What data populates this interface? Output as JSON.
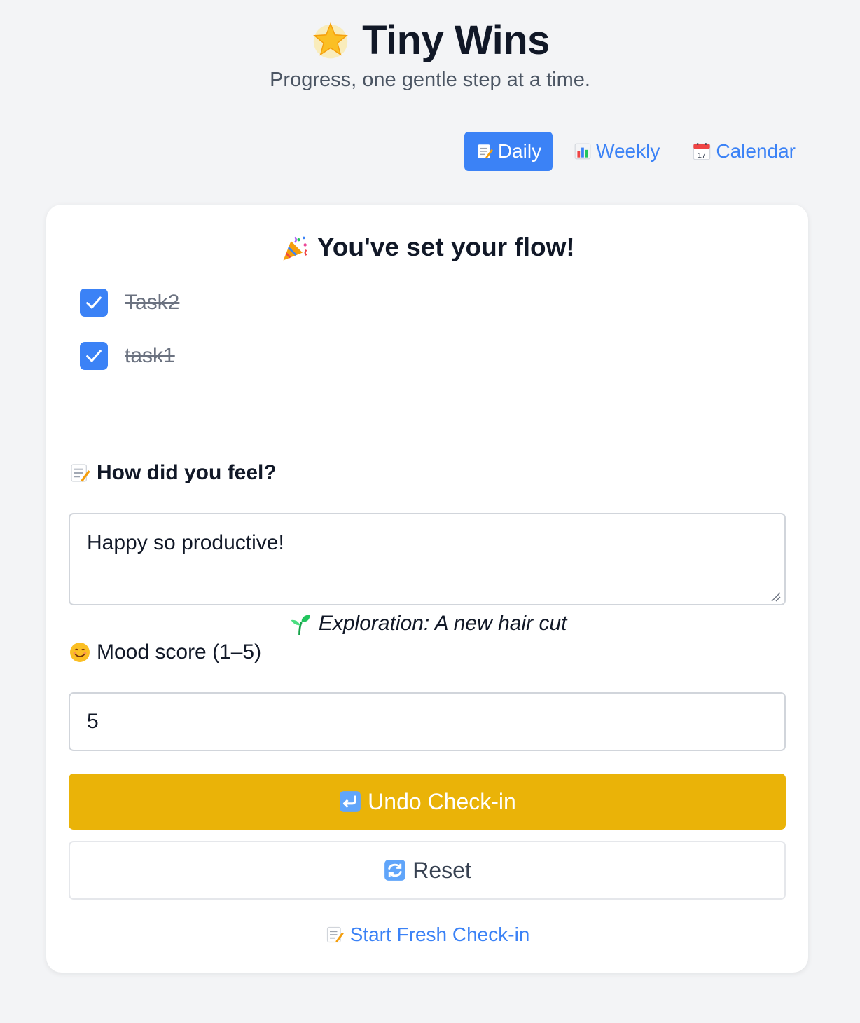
{
  "app": {
    "title": "Tiny Wins",
    "subtitle": "Progress, one gentle step at a time.",
    "title_icon": "star-icon"
  },
  "tabs": [
    {
      "label": "Daily",
      "icon": "memo-icon",
      "active": true
    },
    {
      "label": "Weekly",
      "icon": "bar-chart-icon",
      "active": false
    },
    {
      "label": "Calendar",
      "icon": "calendar-icon",
      "active": false
    }
  ],
  "card": {
    "title": "You've set your flow!",
    "title_icon": "party-popper-icon",
    "tasks": [
      {
        "label": "Task2",
        "checked": true
      },
      {
        "label": "task1",
        "checked": true
      }
    ],
    "exploration": "Exploration: A new hair cut",
    "exploration_icon": "seedling-icon",
    "feel_label": "How did you feel?",
    "feel_value": "Happy so productive!",
    "mood_label": "Mood score (1–5)",
    "mood_value": "5",
    "undo_label": "Undo Check-in",
    "reset_label": "Reset",
    "fresh_label": "Start Fresh Check-in"
  },
  "colors": {
    "accent": "#3b82f6",
    "undo": "#eab308",
    "background": "#f3f4f6"
  }
}
